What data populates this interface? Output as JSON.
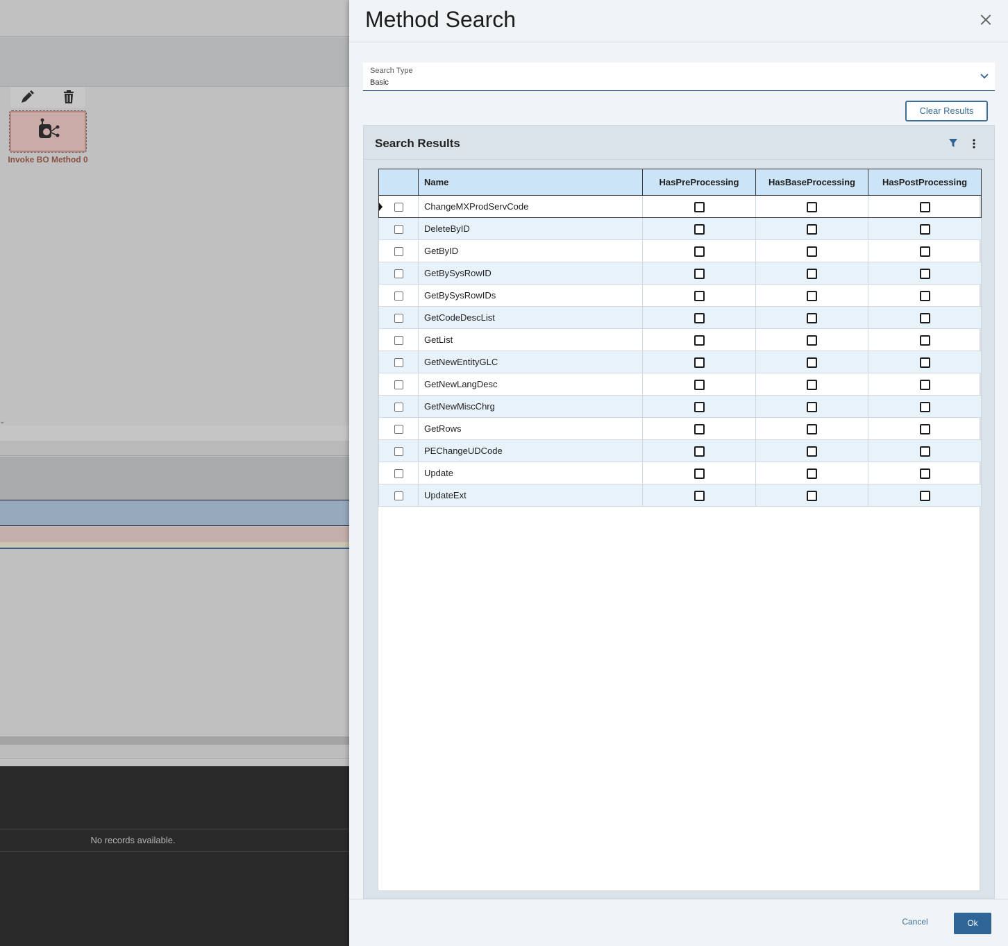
{
  "background": {
    "node_label": "Invoke BO Method 0",
    "toolbar_icons": [
      "edit-icon",
      "trash-icon"
    ],
    "node_icon": "service-node-icon",
    "empty_message": "No records available."
  },
  "panel": {
    "title": "Method Search",
    "search_type": {
      "label": "Search Type",
      "value": "Basic"
    },
    "clear_results_label": "Clear Results",
    "results": {
      "title": "Search Results",
      "columns": [
        "Name",
        "HasPreProcessing",
        "HasBaseProcessing",
        "HasPostProcessing"
      ],
      "rows": [
        {
          "name": "ChangeMXProdServCode"
        },
        {
          "name": "DeleteByID"
        },
        {
          "name": "GetByID"
        },
        {
          "name": "GetBySysRowID"
        },
        {
          "name": "GetBySysRowIDs"
        },
        {
          "name": "GetCodeDescList"
        },
        {
          "name": "GetList"
        },
        {
          "name": "GetNewEntityGLC"
        },
        {
          "name": "GetNewLangDesc"
        },
        {
          "name": "GetNewMiscChrg"
        },
        {
          "name": "GetRows"
        },
        {
          "name": "PEChangeUDCode"
        },
        {
          "name": "Update"
        },
        {
          "name": "UpdateExt"
        }
      ]
    },
    "footer": {
      "cancel_label": "Cancel",
      "ok_label": "Ok"
    }
  },
  "colors": {
    "accent": "#2f6496",
    "header_row": "#cce4f7",
    "alt_row": "#e8f2fb",
    "panel_bg": "#f0f4f7"
  }
}
